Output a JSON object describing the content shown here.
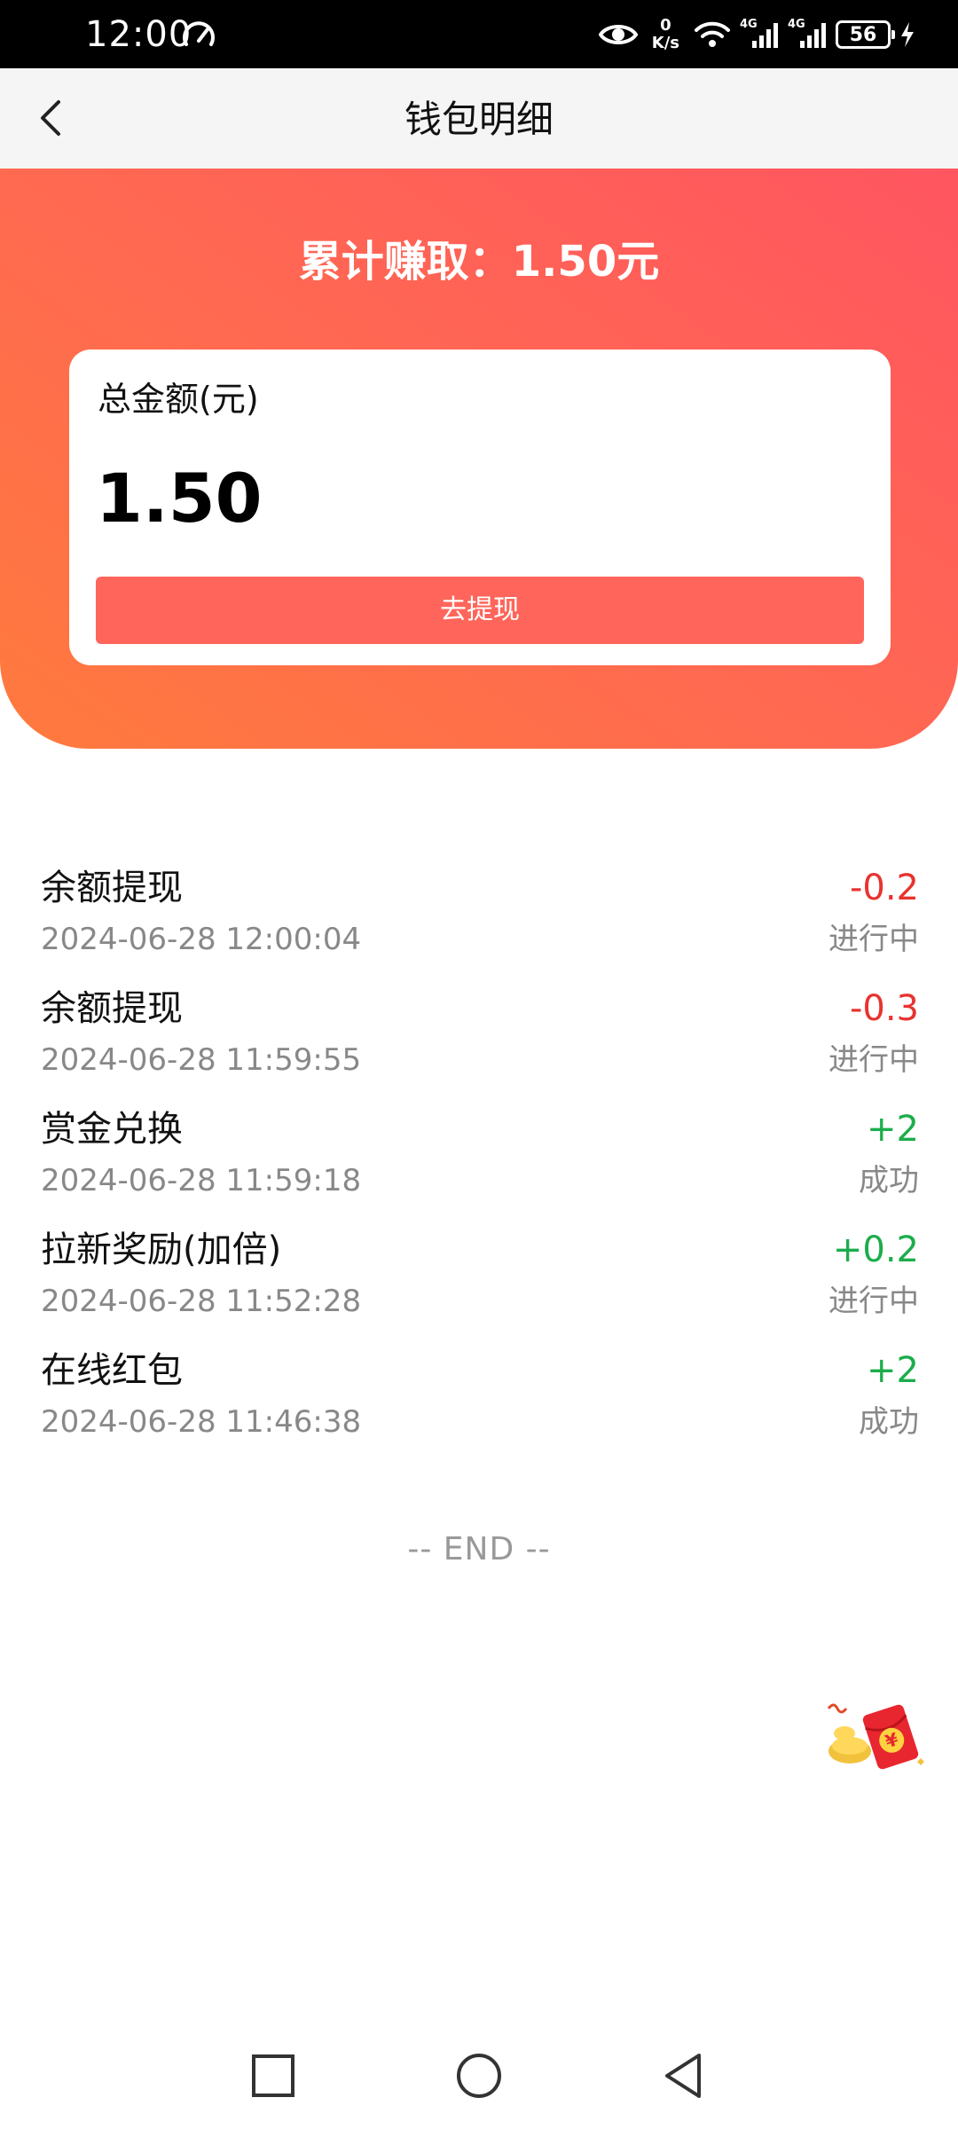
{
  "status_bar": {
    "time": "12:00",
    "net_speed_value": "0",
    "net_speed_unit": "K/s",
    "signal_1_type": "4G",
    "signal_2_type": "4G",
    "battery_level": "56"
  },
  "header": {
    "title": "钱包明细"
  },
  "hero": {
    "earned_text": "累计赚取：1.50元",
    "balance_label": "总金额(元)",
    "balance_amount": "1.50",
    "withdraw_label": "去提现"
  },
  "transactions": [
    {
      "title": "余额提现",
      "time": "2024-06-28 12:00:04",
      "amount": "-0.2",
      "status": "进行中"
    },
    {
      "title": "余额提现",
      "time": "2024-06-28 11:59:55",
      "amount": "-0.3",
      "status": "进行中"
    },
    {
      "title": "赏金兑换",
      "time": "2024-06-28 11:59:18",
      "amount": "+2",
      "status": "成功"
    },
    {
      "title": "拉新奖励(加倍)",
      "time": "2024-06-28 11:52:28",
      "amount": "+0.2",
      "status": "进行中"
    },
    {
      "title": "在线红包",
      "time": "2024-06-28 11:46:38",
      "amount": "+2",
      "status": "成功"
    }
  ],
  "end_marker": "-- END --",
  "colors": {
    "hero_gradient_start": "#ff7a3d",
    "hero_gradient_end": "#ff5560",
    "withdraw_button": "#ff655a",
    "negative_amount": "#e8332f",
    "positive_amount": "#1cad4b",
    "secondary_text": "#888888"
  },
  "icons": {
    "back": "chevron-left-icon",
    "speedometer": "speedometer-icon",
    "eye": "eye-icon",
    "wifi": "wifi-icon",
    "signal": "signal-icon",
    "battery": "battery-icon",
    "charging": "bolt-icon",
    "floating": "red-packet-icon",
    "nav_recent": "square-icon",
    "nav_home": "circle-icon",
    "nav_back": "triangle-back-icon"
  }
}
